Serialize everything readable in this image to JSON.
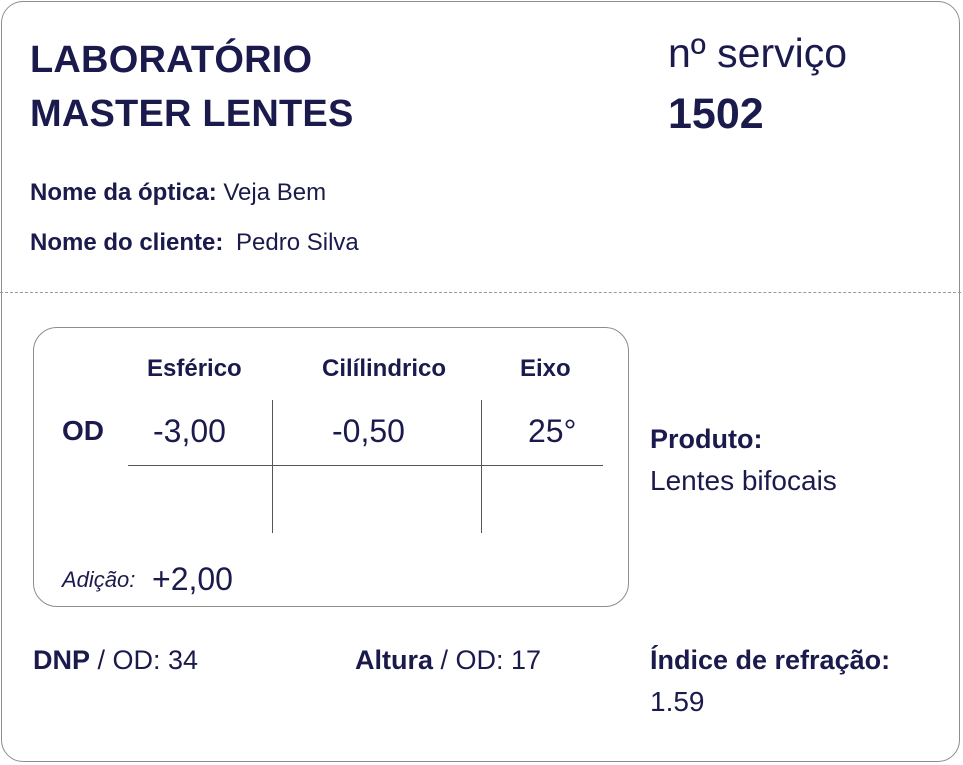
{
  "header": {
    "lab_line1": "LABORATÓRIO",
    "lab_line2": "MASTER LENTES",
    "service_label": "nº serviço",
    "service_number": "1502"
  },
  "fields": {
    "optica_label": "Nome da óptica:",
    "optica_value": "Veja Bem",
    "cliente_label": "Nome do cliente:",
    "cliente_value": "Pedro Silva"
  },
  "prescription": {
    "col_esferico": "Esférico",
    "col_cilindrico": "Cilílindrico",
    "col_eixo": "Eixo",
    "eye_label": "OD",
    "esferico": "-3,00",
    "cilindrico": "-0,50",
    "eixo": "25°",
    "adicao_label": "Adição:",
    "adicao_value": "+2,00"
  },
  "product": {
    "label": "Produto:",
    "value": "Lentes bifocais"
  },
  "measurements": {
    "dnp_label": "DNP",
    "dnp_value": " / OD: 34",
    "altura_label": "Altura",
    "altura_value": " / OD: 17",
    "indice_label": "Índice de refração:",
    "indice_value": "1.59"
  }
}
